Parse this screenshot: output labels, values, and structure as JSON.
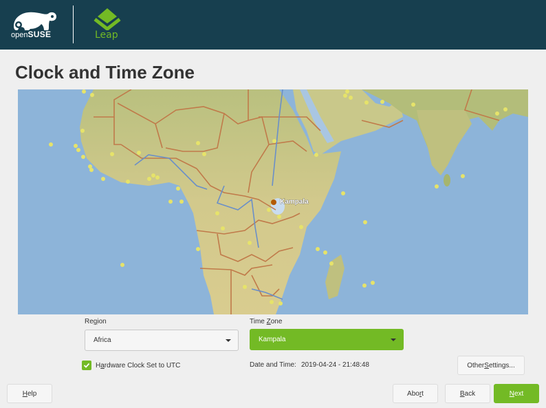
{
  "header": {
    "brand": "openSUSE",
    "brand_prefix": "open",
    "brand_suffix": "SUSE",
    "product": "Leap"
  },
  "page": {
    "title": "Clock and Time Zone"
  },
  "map": {
    "selected_city": "Kampala",
    "colors": {
      "ocean": "#8db4d9",
      "land": "#c9c88a",
      "border": "#c07a4a",
      "river": "#6a8fc8",
      "city_dot": "#e6e36a",
      "selected_dot": "#b35a00"
    }
  },
  "region": {
    "label_pre": "Re",
    "label_mnemonic": "g",
    "label_post": "ion",
    "value": "Africa"
  },
  "timezone": {
    "label_pre": "Time ",
    "label_mnemonic": "Z",
    "label_post": "one",
    "value": "Kampala"
  },
  "hardware_clock": {
    "checked": true,
    "label_pre": "H",
    "label_mnemonic": "a",
    "label_post": "rdware Clock Set to UTC"
  },
  "datetime": {
    "label": "Date and Time:",
    "value": "2019-04-24 - 21:48:48"
  },
  "buttons": {
    "other_settings": {
      "pre": "Other ",
      "mnemonic": "S",
      "post": "ettings..."
    },
    "help": {
      "pre": "",
      "mnemonic": "H",
      "post": "elp"
    },
    "abort": {
      "pre": "Abo",
      "mnemonic": "r",
      "post": "t"
    },
    "back": {
      "pre": "",
      "mnemonic": "B",
      "post": "ack"
    },
    "next": {
      "pre": "",
      "mnemonic": "N",
      "post": "ext"
    }
  },
  "colors": {
    "header_bg": "#173f4f",
    "accent": "#73ba25",
    "page_bg": "#efefef"
  }
}
